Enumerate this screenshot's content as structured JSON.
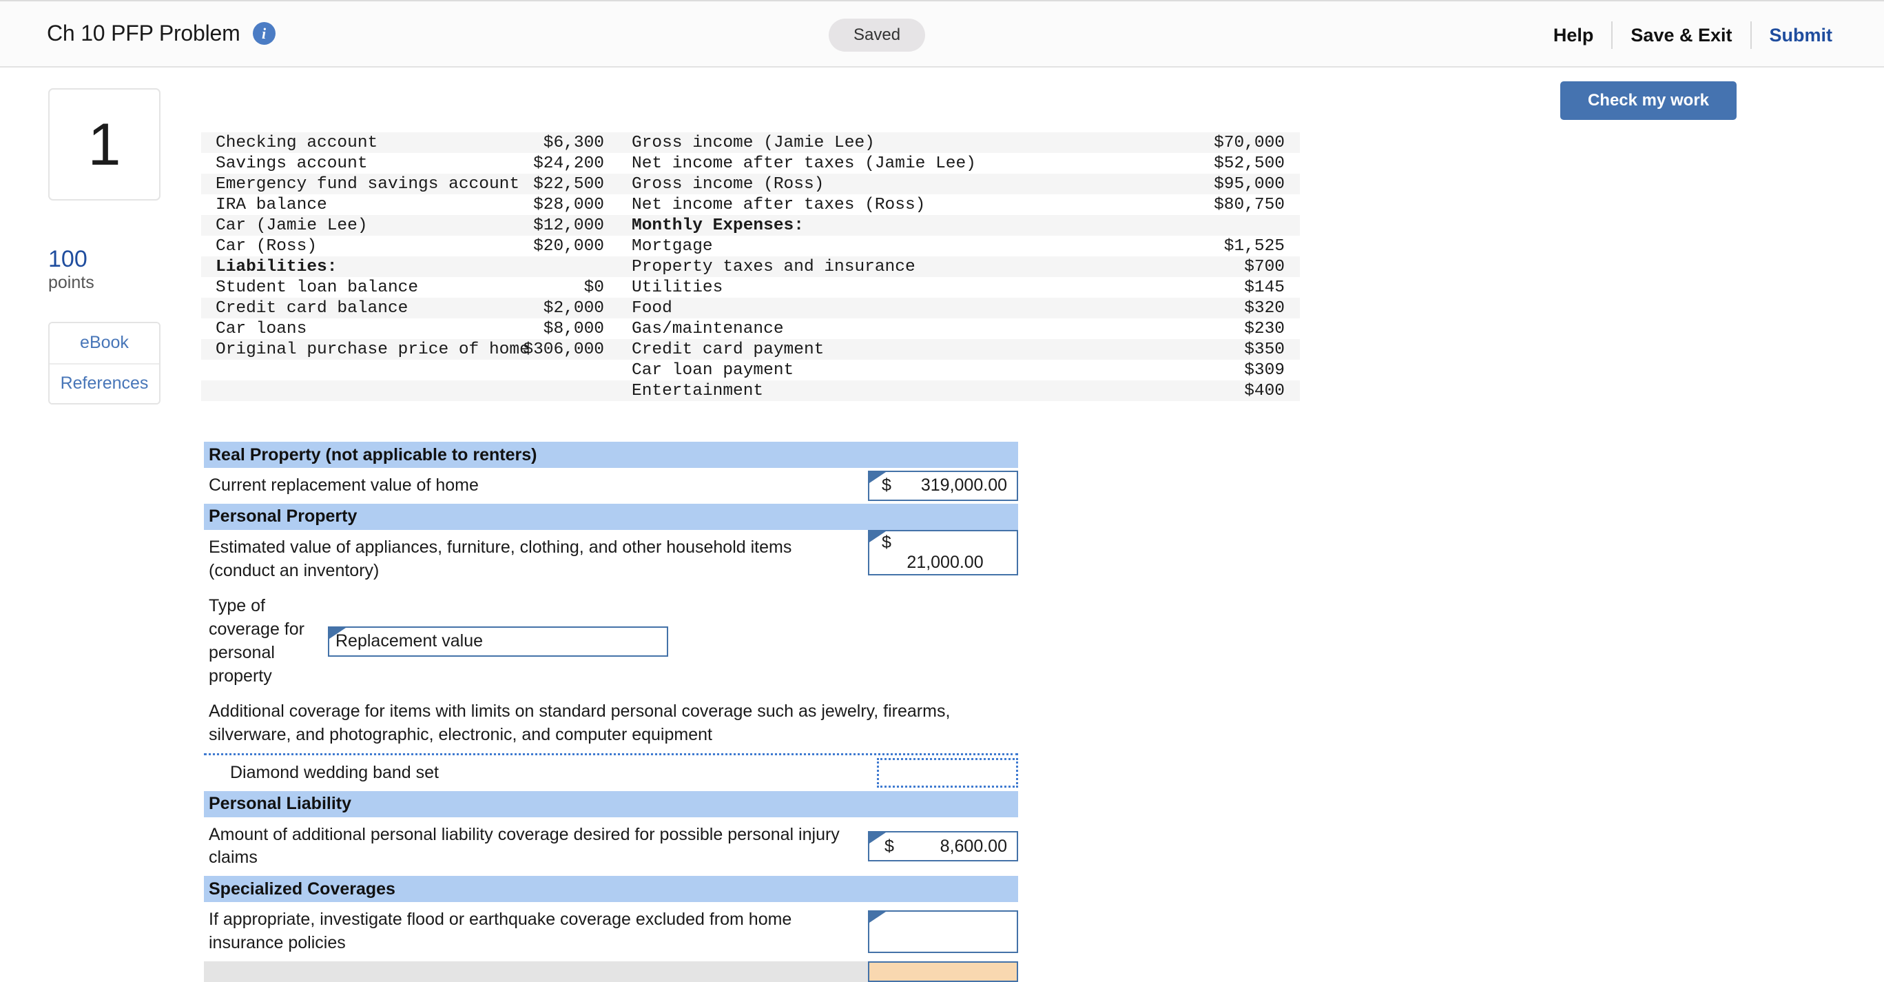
{
  "header": {
    "title": "Ch 10 PFP Problem",
    "info_icon": "info-icon",
    "status_pill": "Saved",
    "links": [
      {
        "label": "Help",
        "accent": false
      },
      {
        "label": "Save & Exit",
        "accent": false
      },
      {
        "label": "Submit",
        "accent": true
      }
    ],
    "check_my_work": "Check my work"
  },
  "sidebar": {
    "question_number": "1",
    "points_value": "100",
    "points_label": "points",
    "resources": [
      {
        "label": "eBook"
      },
      {
        "label": "References"
      }
    ]
  },
  "data_table": {
    "left_rows": [
      {
        "label": "Checking account",
        "value": "$6,300",
        "bold": false
      },
      {
        "label": "Savings account",
        "value": "$24,200",
        "bold": false
      },
      {
        "label": "Emergency fund savings account",
        "value": "$22,500",
        "bold": false
      },
      {
        "label": "IRA balance",
        "value": "$28,000",
        "bold": false
      },
      {
        "label": "Car (Jamie Lee)",
        "value": "$12,000",
        "bold": false
      },
      {
        "label": "Car (Ross)",
        "value": "$20,000",
        "bold": false
      },
      {
        "label": "Liabilities:",
        "value": "",
        "bold": true
      },
      {
        "label": "Student loan balance",
        "value": "$0",
        "bold": false
      },
      {
        "label": "Credit card balance",
        "value": "$2,000",
        "bold": false
      },
      {
        "label": "Car loans",
        "value": "$8,000",
        "bold": false
      },
      {
        "label": "Original purchase price of home",
        "value": "$306,000",
        "bold": false
      },
      {
        "label": "",
        "value": "",
        "bold": false
      },
      {
        "label": "",
        "value": "",
        "bold": false
      }
    ],
    "right_rows": [
      {
        "label": "Gross income (Jamie Lee)",
        "value": "$70,000",
        "bold": false
      },
      {
        "label": "Net income after taxes (Jamie Lee)",
        "value": "$52,500",
        "bold": false
      },
      {
        "label": "Gross income (Ross)",
        "value": "$95,000",
        "bold": false
      },
      {
        "label": "Net income after taxes (Ross)",
        "value": "$80,750",
        "bold": false
      },
      {
        "label": "Monthly Expenses:",
        "value": "",
        "bold": true
      },
      {
        "label": "Mortgage",
        "value": "$1,525",
        "bold": false
      },
      {
        "label": "Property taxes and insurance",
        "value": "$700",
        "bold": false
      },
      {
        "label": "Utilities",
        "value": "$145",
        "bold": false
      },
      {
        "label": "Food",
        "value": "$320",
        "bold": false
      },
      {
        "label": "Gas/maintenance",
        "value": "$230",
        "bold": false
      },
      {
        "label": "Credit card payment",
        "value": "$350",
        "bold": false
      },
      {
        "label": "Car loan payment",
        "value": "$309",
        "bold": false
      },
      {
        "label": "Entertainment",
        "value": "$400",
        "bold": false
      }
    ]
  },
  "worksheet": {
    "real_property": {
      "heading": "Real Property (not applicable to renters)",
      "row_label": "Current replacement value of home",
      "currency": "$",
      "amount": "319,000.00"
    },
    "personal_property": {
      "heading": "Personal Property",
      "estimated_label": "Estimated value of appliances, furniture, clothing, and other household items (conduct an inventory)",
      "estimated_currency": "$",
      "estimated_amount": "21,000.00",
      "coverage_type_label": "Type of coverage for personal property",
      "coverage_type_value": "Replacement value",
      "additional_label": "Additional coverage for items with limits on standard personal coverage such as jewelry, firearms, silverware, and photographic, electronic, and computer equipment",
      "item_label": "Diamond wedding band set",
      "item_value": ""
    },
    "personal_liability": {
      "heading": "Personal Liability",
      "row_label": "Amount of additional personal liability coverage desired for possible personal injury claims",
      "currency": "$",
      "amount": "8,600.00"
    },
    "specialized_coverages": {
      "heading": "Specialized Coverages",
      "row_label": "If appropriate, investigate flood or earthquake coverage excluded from home insurance policies",
      "value": "",
      "partial_row_label": "",
      "partial_row_value": ""
    }
  },
  "colors": {
    "section_header_blue": "#b0cdf2",
    "accent_blue": "#1f4d9e",
    "button_blue": "#4573b0",
    "cell_border_blue": "#4472a8",
    "dotted_blue": "#3f7ad0",
    "orange_cell": "#f9d8b0",
    "stripe_grey": "#f5f5f5"
  }
}
